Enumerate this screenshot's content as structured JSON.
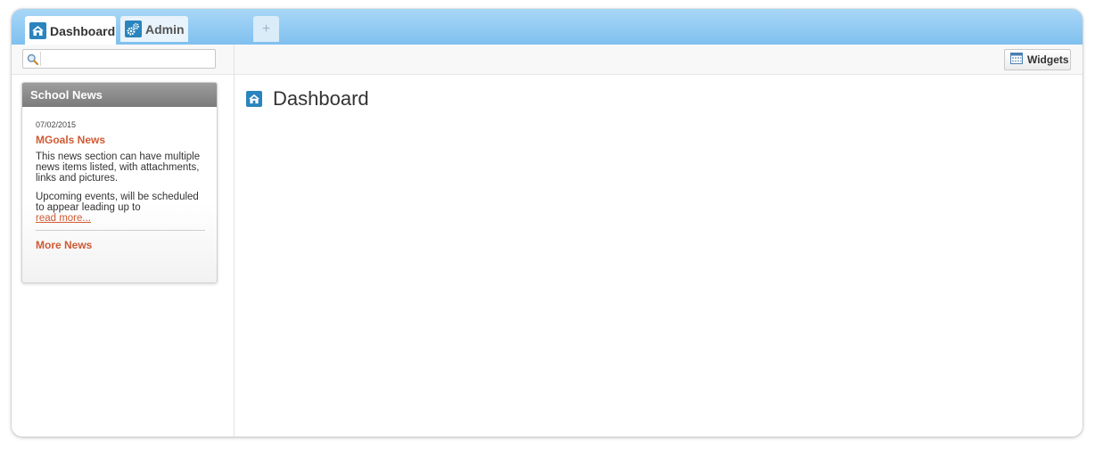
{
  "tabs": [
    {
      "label": "Dashboard",
      "icon": "home-icon",
      "active": true
    },
    {
      "label": "Admin",
      "icon": "gears-icon",
      "active": false
    }
  ],
  "add_tab_label": "+",
  "search": {
    "placeholder": "",
    "value": ""
  },
  "toolbar": {
    "widgets_label": "Widgets"
  },
  "news": {
    "header": "School News",
    "items": [
      {
        "date": "07/02/2015",
        "title": "MGoals News",
        "paragraphs": [
          "This news section can have multiple news items listed, with attachments, links and pictures.",
          "Upcoming events, will be scheduled to appear leading up to"
        ],
        "read_more": "read more..."
      }
    ],
    "more_news": "More News"
  },
  "main": {
    "title": "Dashboard",
    "title_icon": "home-icon"
  },
  "colors": {
    "accent_blue": "#2a84bd",
    "link_orange": "#d05a33",
    "tabbar_top": "#a9d7f7",
    "tabbar_bottom": "#7fc0ef"
  }
}
